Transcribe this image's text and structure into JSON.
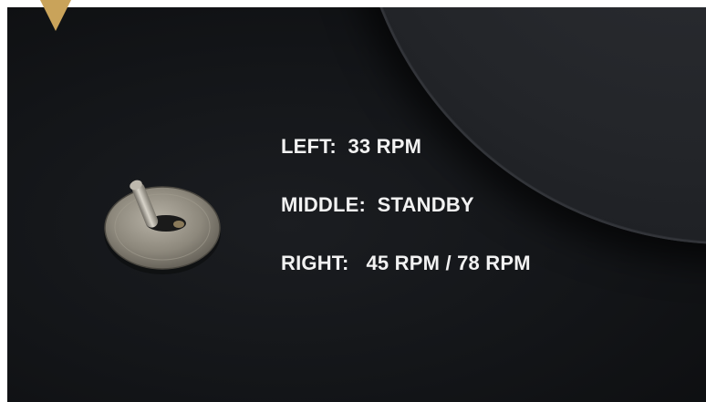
{
  "caption": {
    "left_line": "LEFT:  33 RPM",
    "middle_line": "MIDDLE:  STANDBY",
    "right_line": "RIGHT:   45 RPM / 78 RPM"
  },
  "colors": {
    "background": "#131518",
    "marker": "#c9a35a",
    "text": "#f2f2f2"
  }
}
